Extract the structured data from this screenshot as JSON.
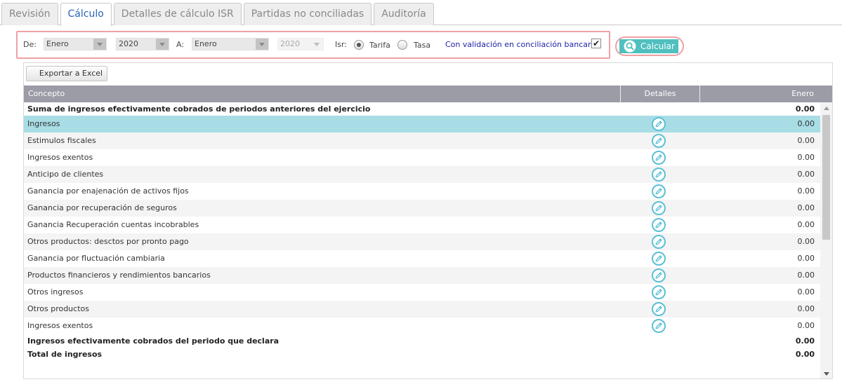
{
  "tabs": [
    {
      "label": "Revisión",
      "active": false
    },
    {
      "label": "Cálculo",
      "active": true
    },
    {
      "label": "Detalles de cálculo ISR",
      "active": false
    },
    {
      "label": "Partidas no conciliadas",
      "active": false
    },
    {
      "label": "Auditoría",
      "active": false
    }
  ],
  "filters": {
    "from_label": "De:",
    "from_month": "Enero",
    "from_year": "2020",
    "to_label": "A:",
    "to_month": "Enero",
    "to_year": "2020",
    "isr_label": "Isr:",
    "option_tarifa": "Tarifa",
    "option_tasa": "Tasa",
    "selected_option": "Tarifa",
    "validation_link": "Con validación en conciliación bancaria",
    "validation_checked": true
  },
  "calculate_button": "Calcular",
  "export_button": "Exportar a Excel",
  "grid": {
    "columns": [
      "Concepto",
      "Detalles",
      "Enero"
    ],
    "rows": [
      {
        "concepto": "Suma de ingresos efectivamente cobrados de periodos anteriores del ejercicio",
        "enero": "0.00",
        "bold": true,
        "details": false
      },
      {
        "concepto": "Ingresos",
        "enero": "0.00",
        "selected": true,
        "details": true
      },
      {
        "concepto": "Estimulos fiscales",
        "enero": "0.00",
        "details": true
      },
      {
        "concepto": "Ingresos exentos",
        "enero": "0.00",
        "details": true
      },
      {
        "concepto": "Anticipo de clientes",
        "enero": "0.00",
        "details": true
      },
      {
        "concepto": "Ganancia por enajenación de activos fijos",
        "enero": "0.00",
        "details": true
      },
      {
        "concepto": "Ganancia por recuperación de seguros",
        "enero": "0.00",
        "details": true
      },
      {
        "concepto": "Ganancia Recuperación cuentas incobrables",
        "enero": "0.00",
        "details": true
      },
      {
        "concepto": "Otros productos: desctos por pronto pago",
        "enero": "0.00",
        "details": true
      },
      {
        "concepto": "Ganancia por fluctuación cambiaria",
        "enero": "0.00",
        "details": true
      },
      {
        "concepto": "Productos financieros y rendimientos bancarios",
        "enero": "0.00",
        "details": true
      },
      {
        "concepto": "Otros ingresos",
        "enero": "0.00",
        "details": true
      },
      {
        "concepto": "Otros productos",
        "enero": "0.00",
        "details": true
      },
      {
        "concepto": "Ingresos exentos",
        "enero": "0.00",
        "details": true
      },
      {
        "concepto": "Ingresos efectivamente cobrados del periodo que declara",
        "enero": "0.00",
        "bold": true,
        "details": false
      },
      {
        "concepto": "Total de ingresos",
        "enero": "0.00",
        "bold": true,
        "details": false
      }
    ]
  },
  "colors": {
    "accent": "#50bfbf",
    "highlight_border": "#f0a0a5",
    "selected_row": "#a8dde6",
    "header_bg": "#9b9ca6",
    "active_tab_text": "#2a63b8",
    "link_text": "#2222aa"
  }
}
